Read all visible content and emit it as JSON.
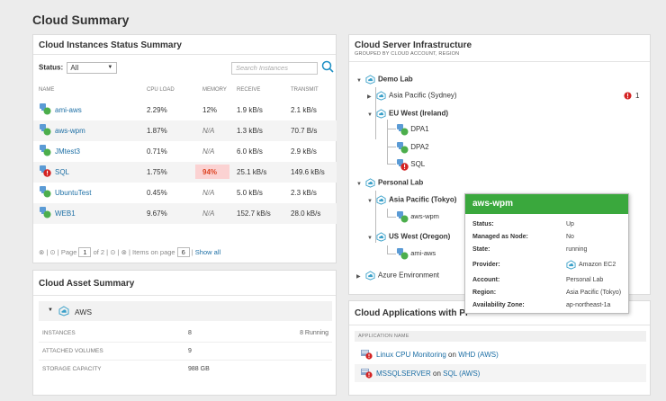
{
  "page": {
    "title": "Cloud Summary"
  },
  "instances": {
    "title": "Cloud Instances Status Summary",
    "status_label": "Status:",
    "status_value": "All",
    "search_placeholder": "Search Instances",
    "columns": [
      "NAME",
      "CPU LOAD",
      "MEMORY",
      "RECEIVE",
      "TRANSMIT"
    ],
    "rows": [
      {
        "name": "ami-aws",
        "cpu": "2.29%",
        "memory": "12%",
        "receive": "1.9 kB/s",
        "transmit": "2.1 kB/s"
      },
      {
        "name": "aws-wpm",
        "cpu": "1.87%",
        "memory": "N/A",
        "receive": "1.3 kB/s",
        "transmit": "70.7 B/s"
      },
      {
        "name": "JMtest3",
        "cpu": "0.71%",
        "memory": "N/A",
        "receive": "6.0 kB/s",
        "transmit": "2.9 kB/s"
      },
      {
        "name": "SQL",
        "cpu": "1.75%",
        "memory": "94%",
        "receive": "25.1 kB/s",
        "transmit": "149.6 kB/s"
      },
      {
        "name": "UbuntuTest",
        "cpu": "0.45%",
        "memory": "N/A",
        "receive": "5.0 kB/s",
        "transmit": "2.3 kB/s"
      },
      {
        "name": "WEB1",
        "cpu": "9.67%",
        "memory": "N/A",
        "receive": "152.7 kB/s",
        "transmit": "28.0 kB/s"
      }
    ],
    "pager": {
      "page_label": "Page",
      "page_value": "1",
      "of_label": "of 2",
      "items_label": "Items on page",
      "items_value": "6",
      "show_all": "Show all"
    }
  },
  "asset": {
    "title": "Cloud Asset Summary",
    "group": "AWS",
    "rows": [
      {
        "label": "INSTANCES",
        "value": "8",
        "extra": "8 Running"
      },
      {
        "label": "ATTACHED VOLUMES",
        "value": "9",
        "extra": ""
      },
      {
        "label": "STORAGE CAPACITY",
        "value": "988 GB",
        "extra": ""
      }
    ]
  },
  "infra": {
    "title": "Cloud Server Infrastructure",
    "subtitle": "GROUPED BY CLOUD ACCOUNT, REGION",
    "demo_lab": "Demo Lab",
    "asia_sydney": "Asia Pacific (Sydney)",
    "asia_sydney_count": "1",
    "eu_west": "EU West (Ireland)",
    "dpa1": "DPA1",
    "dpa2": "DPA2",
    "sql": "SQL",
    "personal_lab": "Personal Lab",
    "asia_tokyo": "Asia Pacific (Tokyo)",
    "aws_wpm": "aws-wpm",
    "us_west": "US West (Oregon)",
    "ami_aws": "ami-aws",
    "azure": "Azure Environment"
  },
  "popup": {
    "title": "aws-wpm",
    "rows": [
      {
        "key": "Status:",
        "value": "Up"
      },
      {
        "key": "Managed as Node:",
        "value": "No"
      },
      {
        "key": "State:",
        "value": "running"
      },
      {
        "key": "Provider:",
        "value": "Amazon EC2"
      },
      {
        "key": "Account:",
        "value": "Personal Lab"
      },
      {
        "key": "Region:",
        "value": "Asia Pacific (Tokyo)"
      },
      {
        "key": "Availability Zone:",
        "value": "ap-northeast-1a"
      }
    ]
  },
  "apps": {
    "title": "Cloud Applications with Pr",
    "column": "APPLICATION NAME",
    "rows": [
      {
        "app": "Linux CPU Monitoring",
        "on": "on",
        "target": "WHD (AWS)"
      },
      {
        "app": "MSSQLSERVER",
        "on": "on",
        "target": "SQL (AWS)"
      }
    ]
  },
  "colors": {
    "link": "#1d6fa5",
    "green": "#3aa83d",
    "critical": "#d42323",
    "hot_bg": "#fbd2d2"
  }
}
